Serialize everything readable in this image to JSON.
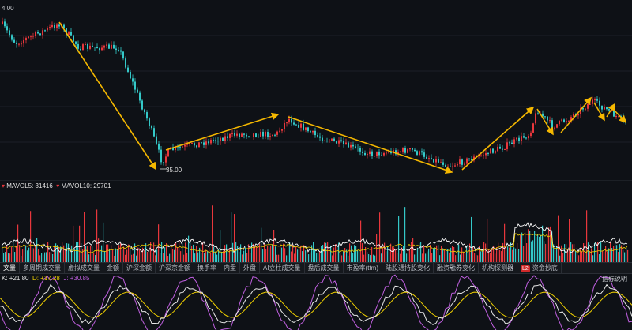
{
  "price_axis_top_label": "4.00",
  "price_low_label": "35.00",
  "volume_legend": {
    "mavol5": "MAVOL5: 31416",
    "mavol10": "MAVOL10: 29701"
  },
  "tabs": [
    {
      "label": "文量"
    },
    {
      "label": "多周期成交量"
    },
    {
      "label": "虚拟成交量"
    },
    {
      "label": "金额"
    },
    {
      "label": "沪深金额"
    },
    {
      "label": "沪深京金额"
    },
    {
      "label": "换手率"
    },
    {
      "label": "内盘"
    },
    {
      "label": "外盘"
    },
    {
      "label": "AI立柱成交量"
    },
    {
      "label": "盘后成交量"
    },
    {
      "label": "市盈率(ttm)"
    },
    {
      "label": "陆股通持股变化"
    },
    {
      "label": "融资融券变化"
    },
    {
      "label": "机构探测器"
    },
    {
      "label": "资金抄底",
      "badge": "L2"
    }
  ],
  "indicator_help_label": "指标说明",
  "kdj_legend": {
    "k": "K: +21.80",
    "d": "D: +17.28",
    "j": "J: +30.85"
  },
  "colors": {
    "up": "#e8373c",
    "down": "#34c8c8",
    "arrow": "#f5b800",
    "k_line": "#e8e8e8",
    "d_line": "#f0d000",
    "j_line": "#c060e0"
  }
}
